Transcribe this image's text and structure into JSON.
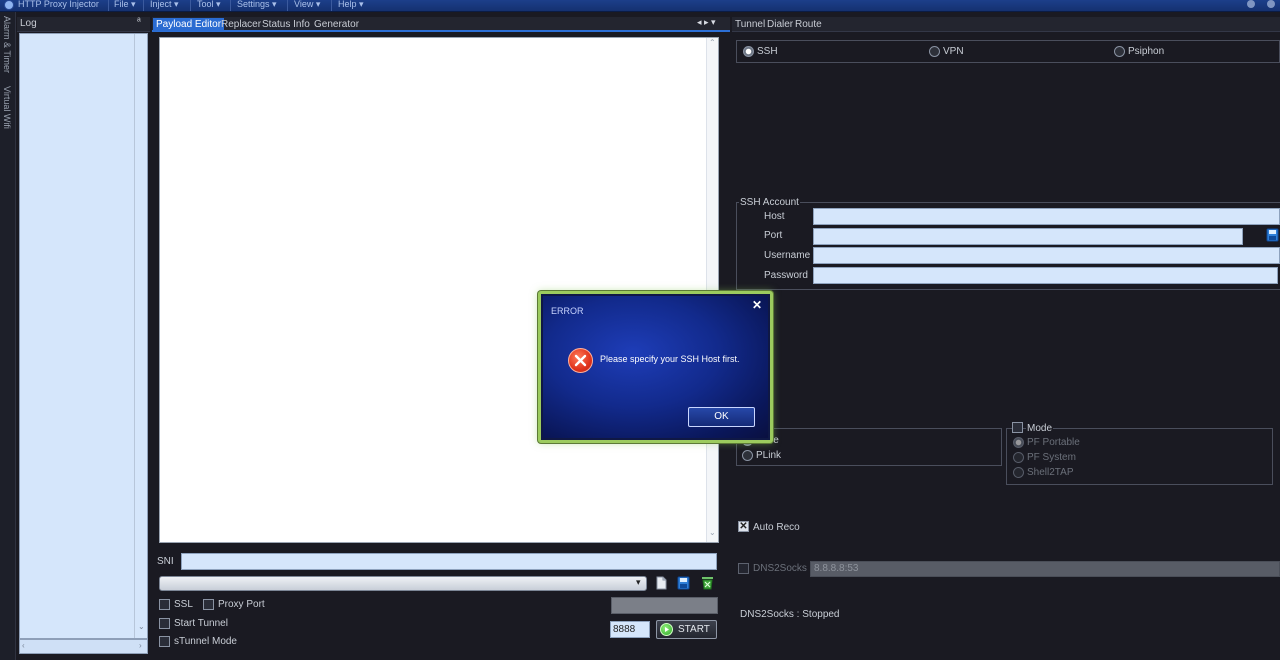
{
  "titlebar": {
    "app_title": "HTTP Proxy Injector",
    "menus": [
      "File ▾",
      "Inject ▾",
      "Tool ▾",
      "Settings ▾",
      "View ▾",
      "Help ▾"
    ]
  },
  "left_strip": {
    "items": [
      "Alarm & Timer",
      "Virtual Wifi"
    ]
  },
  "log_panel": {
    "title": "Log",
    "pin": "ᵃ"
  },
  "middle": {
    "tabs": [
      {
        "label": "Payload Editor",
        "active": true
      },
      {
        "label": "Replacer",
        "active": false
      },
      {
        "label": "Status Info",
        "active": false
      },
      {
        "label": "Generator",
        "active": false
      }
    ],
    "tab_arrows": "◂ ▸ ▾",
    "sni_label": "SNI",
    "sni_value": "",
    "ssl_label": "SSL",
    "proxy_port_label": "Proxy Port",
    "start_tunnel_label": "Start Tunnel",
    "stunnel_label": "sTunnel Mode",
    "port_value": "8888",
    "start_label": "START"
  },
  "right": {
    "tabs": [
      "Tunnel",
      "Dialer",
      "Route"
    ],
    "protocols": [
      {
        "label": "SSH",
        "selected": true
      },
      {
        "label": "VPN",
        "selected": false
      },
      {
        "label": "Psiphon",
        "selected": false
      }
    ],
    "ssh_account": {
      "title": "SSH Account",
      "host_label": "Host",
      "port_label": "Port",
      "username_label": "Username",
      "password_label": "Password"
    },
    "inject_group": {
      "title": "r",
      "options": [
        {
          "label": "Ntlse",
          "selected": true
        },
        {
          "label": "PLink",
          "selected": false
        }
      ]
    },
    "mode_group": {
      "title": "Mode",
      "options": [
        "PF Portable",
        "PF System",
        "Shell2TAP"
      ]
    },
    "auto_reco_label": "Auto Reco",
    "dns_label": "DNS2Socks",
    "dns_value": "8.8.8.8:53",
    "dns_status": "DNS2Socks : Stopped"
  },
  "dialog": {
    "title": "ERROR",
    "close": "✕",
    "message": "Please specify your SSH Host first.",
    "ok_label": "OK"
  },
  "colors": {
    "accent": "#2a6bd1",
    "field": "#d5e6fb",
    "dialog_border": "#9ccb5e",
    "error_red": "#e0331c"
  }
}
